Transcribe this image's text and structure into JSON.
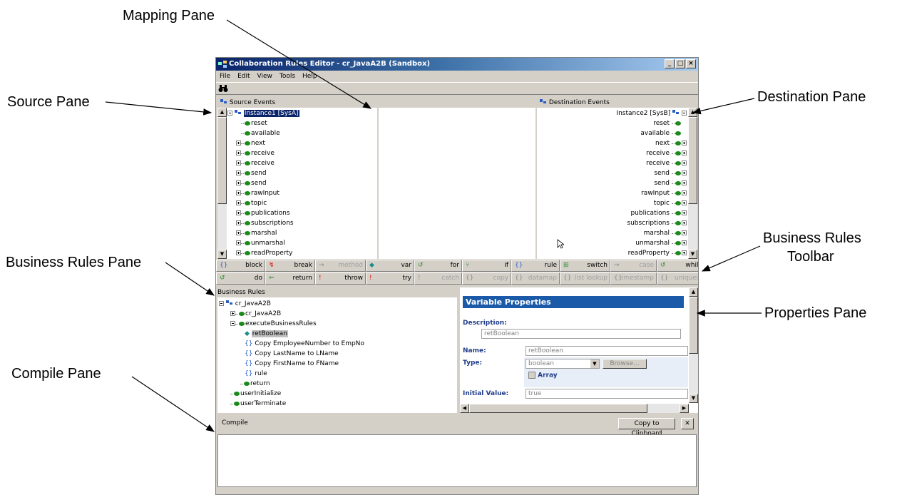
{
  "callouts": {
    "mapping": "Mapping Pane",
    "source": "Source Pane",
    "destination": "Destination Pane",
    "business_rules_pane": "Business Rules Pane",
    "business_rules_toolbar_1": "Business Rules",
    "business_rules_toolbar_2": "Toolbar",
    "properties": "Properties Pane",
    "compile": "Compile Pane"
  },
  "window": {
    "title": "Collaboration Rules Editor - cr_JavaA2B (Sandbox)",
    "buttons": {
      "minimize": "_",
      "maximize": "□",
      "close": "×"
    }
  },
  "menu": [
    "File",
    "Edit",
    "View",
    "Tools",
    "Help"
  ],
  "source": {
    "header": "Source Events",
    "root": "Instance1 [SysA]",
    "items": [
      "reset",
      "available",
      "next",
      "receive",
      "receive",
      "send",
      "send",
      "rawInput",
      "topic",
      "publications",
      "subscriptions",
      "marshal",
      "unmarshal",
      "readProperty"
    ]
  },
  "destination": {
    "header": "Destination Events",
    "root": "Instance2 [SysB]",
    "items": [
      "reset",
      "available",
      "next",
      "receive",
      "receive",
      "send",
      "send",
      "rawInput",
      "topic",
      "publications",
      "subscriptions",
      "marshal",
      "unmarshal",
      "readProperty"
    ]
  },
  "toolbar": {
    "row1": [
      {
        "icon": "{}",
        "label": "block"
      },
      {
        "icon": "↯",
        "label": "break"
      },
      {
        "icon": "→",
        "label": "method"
      },
      {
        "icon": "◆",
        "label": "var"
      },
      {
        "icon": "↺",
        "label": "for"
      },
      {
        "icon": "⑂",
        "label": "if"
      },
      {
        "icon": "{}",
        "label": "rule"
      },
      {
        "icon": "⊞",
        "label": "switch"
      },
      {
        "icon": "→",
        "label": "case"
      },
      {
        "icon": "↺",
        "label": "while"
      }
    ],
    "row2": [
      {
        "icon": "↺",
        "label": "do"
      },
      {
        "icon": "⇐",
        "label": "return"
      },
      {
        "icon": "!",
        "label": "throw"
      },
      {
        "icon": "!",
        "label": "try"
      },
      {
        "icon": "!",
        "label": "catch"
      },
      {
        "icon": "{}",
        "label": "copy"
      },
      {
        "icon": "{}",
        "label": "datamap"
      },
      {
        "icon": "{}",
        "label": "list lookup"
      },
      {
        "icon": "{}",
        "label": "timestamp"
      },
      {
        "icon": "{}",
        "label": "uniqueid"
      }
    ]
  },
  "business_rules": {
    "header": "Business Rules",
    "root": "cr_JavaA2B",
    "child1": "cr_JavaA2B",
    "child2": "executeBusinessRules",
    "ret": "retBoolean",
    "copy1": "Copy EmployeeNumber to EmpNo",
    "copy2": "Copy LastName to LName",
    "copy3": "Copy FirstName to FName",
    "rule": "rule",
    "return": "return",
    "init": "userInitialize",
    "term": "userTerminate"
  },
  "properties": {
    "title": "Variable Properties",
    "description_label": "Description:",
    "description_value": "retBoolean",
    "name_label": "Name:",
    "name_value": "retBoolean",
    "type_label": "Type:",
    "type_value": "boolean",
    "browse_label": "Browse...",
    "array_label": "Array",
    "initial_label": "Initial Value:",
    "initial_value": "true"
  },
  "compile": {
    "label": "Compile",
    "copy_button": "Copy to Clipboard",
    "close_button": "✕"
  }
}
